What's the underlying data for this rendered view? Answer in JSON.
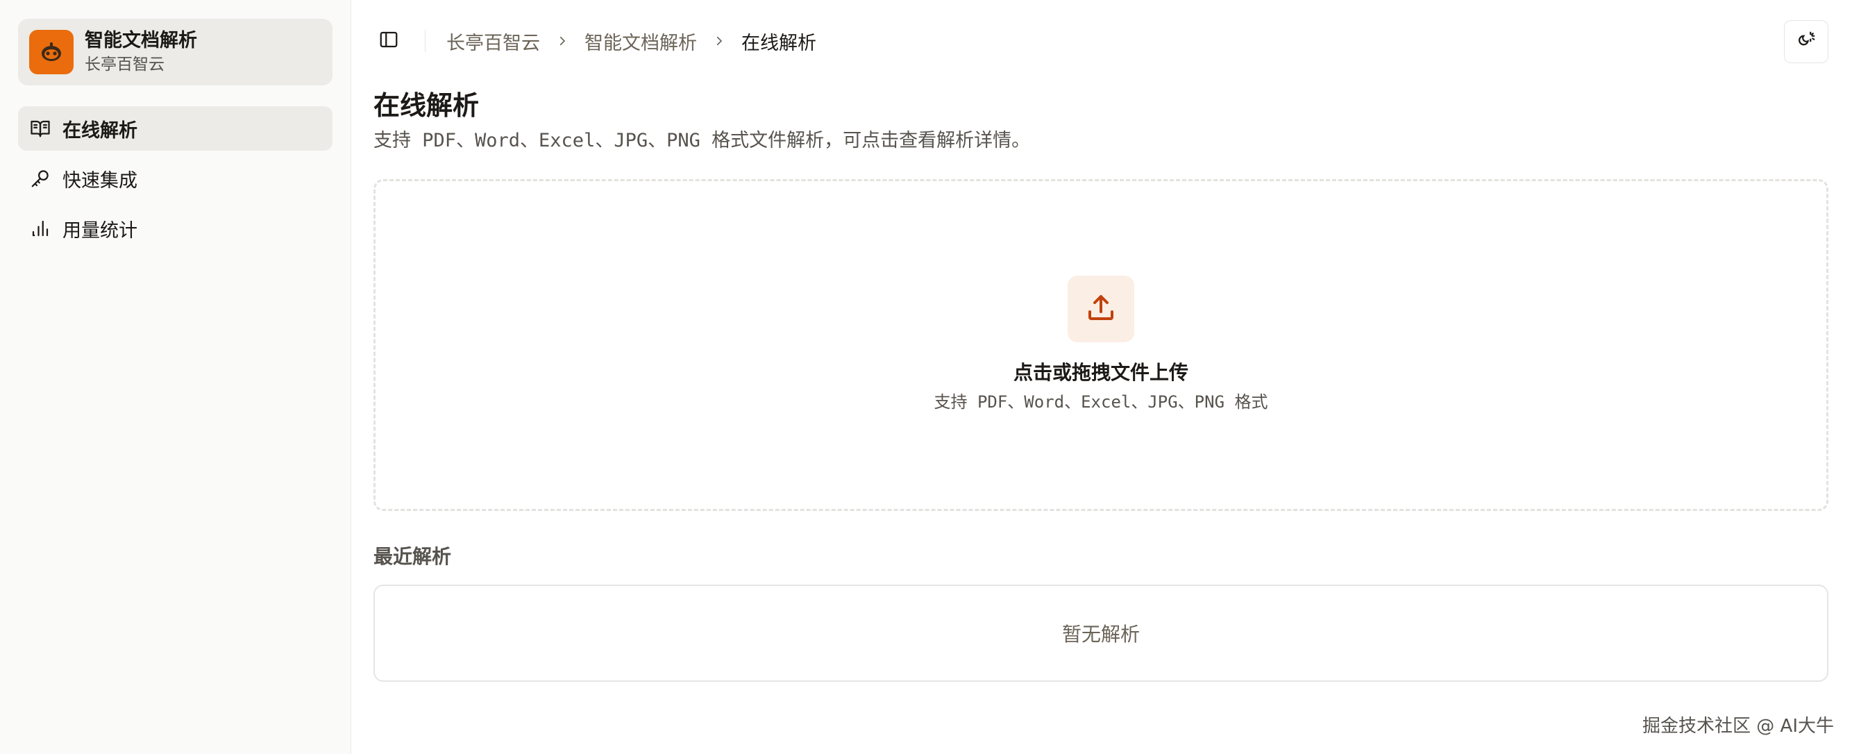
{
  "brand": {
    "name": "智能文档解析",
    "sub": "长亭百智云",
    "logo_icon": "robot-face-icon",
    "accent": "#ea6c0c"
  },
  "sidebar": {
    "items": [
      {
        "label": "在线解析",
        "icon": "book-open-icon",
        "active": true
      },
      {
        "label": "快速集成",
        "icon": "key-icon",
        "active": false
      },
      {
        "label": "用量统计",
        "icon": "bar-chart-icon",
        "active": false
      }
    ]
  },
  "header": {
    "breadcrumb": [
      "长亭百智云",
      "智能文档解析",
      "在线解析"
    ],
    "toggle_icon": "sidebar-toggle-icon",
    "theme_icon": "theme-toggle-icon"
  },
  "page": {
    "title": "在线解析",
    "description": "支持 PDF、Word、Excel、JPG、PNG 格式文件解析，可点击查看解析详情。"
  },
  "upload": {
    "title": "点击或拖拽文件上传",
    "subtitle": "支持 PDF、Word、Excel、JPG、PNG 格式",
    "icon": "upload-icon"
  },
  "recent": {
    "title": "最近解析",
    "empty_text": "暂无解析"
  },
  "watermark": "掘金技术社区 @ AI大牛"
}
